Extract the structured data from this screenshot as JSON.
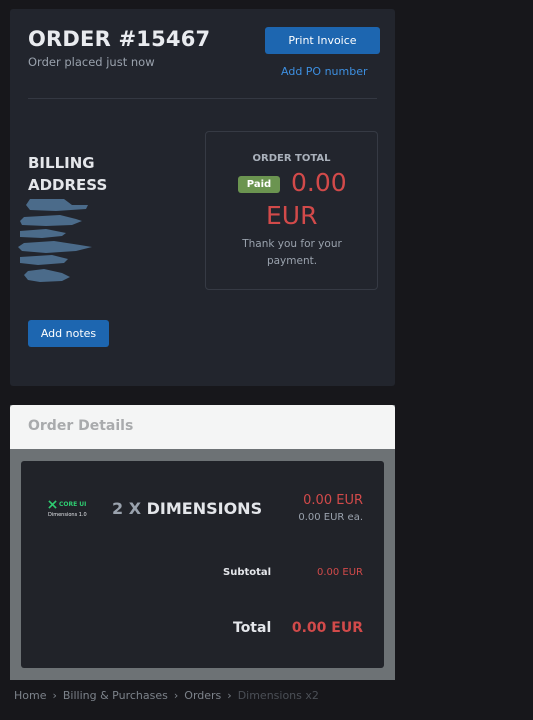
{
  "order": {
    "title": "ORDER #15467",
    "subtitle": "Order placed just now",
    "print_invoice_label": "Print Invoice",
    "add_po_label": "Add PO number",
    "billing_title": "BILLING ADDRESS",
    "total_label": "ORDER TOTAL",
    "paid_badge": "Paid",
    "total_amount": "0.00",
    "total_currency": "EUR",
    "thanks": "Thank you for your payment.",
    "add_notes_label": "Add notes"
  },
  "details": {
    "title": "Order Details",
    "product": {
      "logo_brand": "CORE UI",
      "logo_text": "Dimensions 1.0",
      "quantity": "2 X",
      "name": "DIMENSIONS",
      "line_price": "0.00 EUR",
      "unit_price": "0.00 EUR ea."
    },
    "subtotal_label": "Subtotal",
    "subtotal_value": "0.00 EUR",
    "total_label": "Total",
    "total_value": "0.00 EUR"
  },
  "breadcrumb": {
    "items": [
      "Home",
      "Billing & Purchases",
      "Orders",
      "Dimensions x2"
    ]
  },
  "colors": {
    "accent": "#1d66b0",
    "price": "#d24a4a",
    "paid": "#6b9450",
    "card": "#22252d"
  }
}
